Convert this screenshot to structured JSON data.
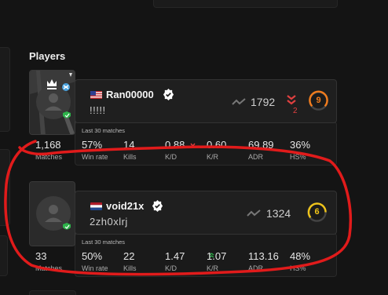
{
  "section_title": "Players",
  "players": [
    {
      "name": "Ran00000",
      "subtitle": "!!!!!",
      "flag": "us",
      "elo": "1792",
      "elo_change": "2",
      "level": "9",
      "level_color": "#f27c1c",
      "last_30": "Last 30 matches",
      "matches_value": "1,168",
      "matches_label": "Matches",
      "stats": [
        {
          "value": "57%",
          "label": "Win rate"
        },
        {
          "value": "14",
          "label": "Kills"
        },
        {
          "value": "0.88",
          "label": "K/D",
          "trend": "down"
        },
        {
          "value": "0.60",
          "label": "K/R"
        },
        {
          "value": "69.89",
          "label": "ADR"
        },
        {
          "value": "36%",
          "label": "HS%"
        }
      ]
    },
    {
      "name": "void21x",
      "subtitle": "2zh0xlrj",
      "flag": "nl",
      "elo": "1324",
      "level": "6",
      "level_color": "#f0c419",
      "last_30": "Last 30 matches",
      "matches_value": "33",
      "matches_label": "Matches",
      "stats": [
        {
          "value": "50%",
          "label": "Win rate"
        },
        {
          "value": "22",
          "label": "Kills"
        },
        {
          "value": "1.47",
          "label": "K/D",
          "trend": "up"
        },
        {
          "value": "1.07",
          "label": "K/R"
        },
        {
          "value": "113.16",
          "label": "ADR"
        },
        {
          "value": "48%",
          "label": "HS%"
        }
      ]
    }
  ],
  "accent_colors": {
    "annotation": "#e11b1b",
    "verified": "#ffffff"
  }
}
